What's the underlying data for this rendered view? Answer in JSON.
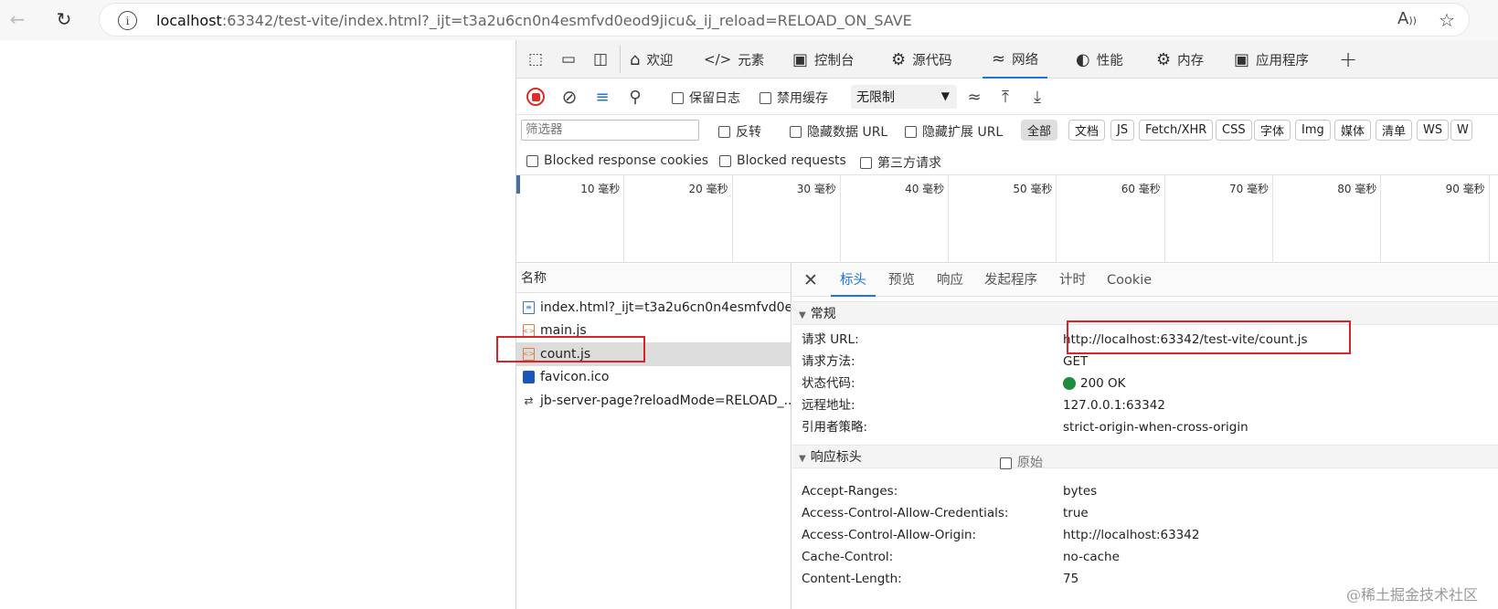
{
  "browser": {
    "url_host": "localhost",
    "url_rest": ":63342/test-vite/index.html?_ijt=t3a2u6cn0n4esmfvd0eod9jicu&_ij_reload=RELOAD_ON_SAVE",
    "read_aloud_icon": "A̅"
  },
  "devtools": {
    "tabs": [
      {
        "label": "欢迎",
        "icon": "home-icon"
      },
      {
        "label": "元素",
        "icon": "code-icon"
      },
      {
        "label": "控制台",
        "icon": "console-icon"
      },
      {
        "label": "源代码",
        "icon": "bug-icon"
      },
      {
        "label": "网络",
        "icon": "wifi-icon"
      },
      {
        "label": "性能",
        "icon": "gauge-icon"
      },
      {
        "label": "内存",
        "icon": "chip-icon"
      },
      {
        "label": "应用程序",
        "icon": "app-icon"
      }
    ],
    "toolbar": {
      "preserve_log": "保留日志",
      "disable_cache": "禁用缓存",
      "throttle": "无限制"
    },
    "filter": {
      "placeholder": "筛选器",
      "invert": "反转",
      "hide_data_url": "隐藏数据 URL",
      "hide_ext_url": "隐藏扩展 URL",
      "types": [
        "全部",
        "文档",
        "JS",
        "Fetch/XHR",
        "CSS",
        "字体",
        "Img",
        "媒体",
        "清单",
        "WS",
        "W"
      ],
      "blocked_cookies": "Blocked response cookies",
      "blocked_requests": "Blocked requests",
      "third_party": "第三方请求"
    },
    "timeline": {
      "ticks": [
        "10 毫秒",
        "20 毫秒",
        "30 毫秒",
        "40 毫秒",
        "50 毫秒",
        "60 毫秒",
        "70 毫秒",
        "80 毫秒",
        "90 毫秒"
      ]
    },
    "requests": {
      "header": "名称",
      "items": [
        {
          "name": "index.html?_ijt=t3a2u6cn0n4esmfvd0e...",
          "type": "doc"
        },
        {
          "name": "main.js",
          "type": "js"
        },
        {
          "name": "count.js",
          "type": "js"
        },
        {
          "name": "favicon.ico",
          "type": "ico"
        },
        {
          "name": "jb-server-page?reloadMode=RELOAD_...",
          "type": "ws"
        }
      ]
    },
    "details": {
      "tabs": [
        "标头",
        "预览",
        "响应",
        "发起程序",
        "计时",
        "Cookie"
      ],
      "general": {
        "title": "常规",
        "rows": [
          {
            "key": "请求 URL:",
            "value": "http://localhost:63342/test-vite/count.js"
          },
          {
            "key": "请求方法:",
            "value": "GET"
          },
          {
            "key": "状态代码:",
            "value": "200 OK"
          },
          {
            "key": "远程地址:",
            "value": "127.0.0.1:63342"
          },
          {
            "key": "引用者策略:",
            "value": "strict-origin-when-cross-origin"
          }
        ]
      },
      "response_headers": {
        "title": "响应标头",
        "raw": "原始",
        "rows": [
          {
            "key": "Accept-Ranges:",
            "value": "bytes"
          },
          {
            "key": "Access-Control-Allow-Credentials:",
            "value": "true"
          },
          {
            "key": "Access-Control-Allow-Origin:",
            "value": "http://localhost:63342"
          },
          {
            "key": "Cache-Control:",
            "value": "no-cache"
          },
          {
            "key": "Content-Length:",
            "value": "75"
          }
        ]
      }
    }
  },
  "watermark": "@稀土掘金技术社区"
}
